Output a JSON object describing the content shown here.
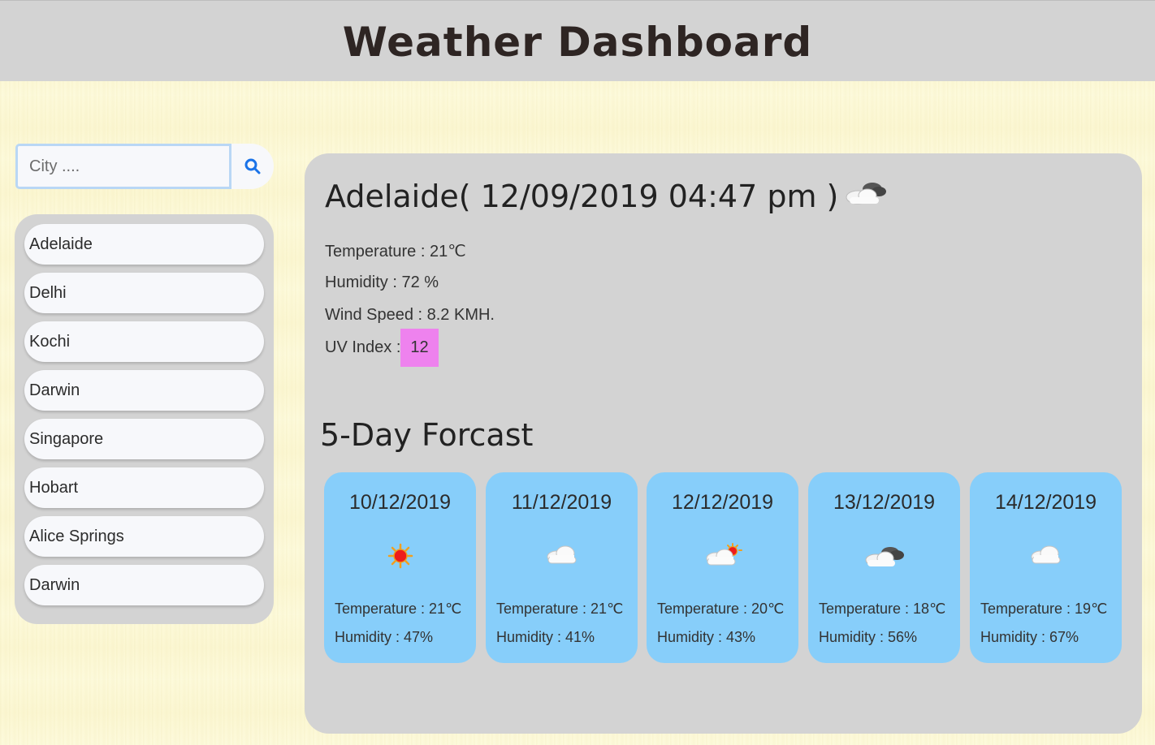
{
  "header": {
    "title": "Weather Dashboard"
  },
  "search": {
    "placeholder": "City ...."
  },
  "cities": [
    "Adelaide",
    "Delhi",
    "Kochi",
    "Darwin",
    "Singapore",
    "Hobart",
    "Alice Springs",
    "Darwin"
  ],
  "current": {
    "title": "Adelaide( 12/09/2019 04:47 pm )",
    "icon": "scattered-clouds-icon",
    "temperature": "Temperature : 21℃",
    "humidity": "Humidity : 72 %",
    "wind": "Wind Speed : 8.2 KMH.",
    "uv_label": "UV Index :",
    "uv_value": "12",
    "uv_color": "#ee82ee"
  },
  "forecast": {
    "title": "5-Day Forcast",
    "card_color": "#87cefa",
    "days": [
      {
        "date": "10/12/2019",
        "icon": "sun-icon",
        "temp": "Temperature : 21℃",
        "humidity": "Humidity : 47%"
      },
      {
        "date": "11/12/2019",
        "icon": "cloud-icon",
        "temp": "Temperature : 21℃",
        "humidity": "Humidity : 41%"
      },
      {
        "date": "12/12/2019",
        "icon": "partly-cloudy-icon",
        "temp": "Temperature : 20℃",
        "humidity": "Humidity : 43%"
      },
      {
        "date": "13/12/2019",
        "icon": "scattered-clouds-icon",
        "temp": "Temperature : 18℃",
        "humidity": "Humidity : 56%"
      },
      {
        "date": "14/12/2019",
        "icon": "cloud-icon",
        "temp": "Temperature : 19℃",
        "humidity": "Humidity : 67%"
      }
    ]
  }
}
